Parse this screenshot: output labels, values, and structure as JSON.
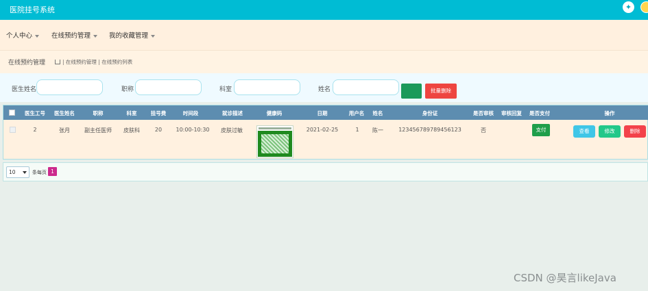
{
  "app": {
    "title": "医院挂号系统"
  },
  "topbar": {
    "settings_icon": "✦"
  },
  "nav": {
    "items": [
      "个人中心",
      "在线预约管理",
      "我的收藏管理"
    ]
  },
  "breadcrumb": {
    "page_title": "在线预约管理",
    "path": "| 在线预约管理 | 在线预约列表"
  },
  "search": {
    "doctor_name_label": "医生姓名",
    "title_label": "职称",
    "department_label": "科室",
    "name_label": "姓名",
    "doctor_name_value": "",
    "title_value": "",
    "department_value": "",
    "name_value": "",
    "batch_delete_label": "批量删除"
  },
  "table": {
    "headers": [
      "医生工号",
      "医生姓名",
      "职称",
      "科室",
      "挂号费",
      "时间段",
      "就诊描述",
      "健康码",
      "日期",
      "用户名",
      "姓名",
      "身份证",
      "是否审核",
      "审核回复",
      "是否支付",
      "操作"
    ],
    "row": {
      "doctor_id": "2",
      "doctor_name": "张月",
      "title": "副主任医师",
      "department": "皮肤科",
      "fee": "20",
      "time_slot": "10:00-10:30",
      "description": "皮肤过敏",
      "date": "2021-02-25",
      "username": "1",
      "name": "陈一",
      "id_card": "123456789789456123",
      "reviewed": "否",
      "review_reply": "",
      "pay_label": "支付",
      "view_label": "查看",
      "edit_label": "修改",
      "delete_label": "删除"
    }
  },
  "pager": {
    "page_size": "10",
    "per_page_label": "条每页",
    "current_page": "1"
  },
  "watermark": "CSDN @昊言likeJava",
  "colors": {
    "topbar": "#00bcd4",
    "table_header": "#5d8db0",
    "page_active": "#cc2a8d"
  }
}
